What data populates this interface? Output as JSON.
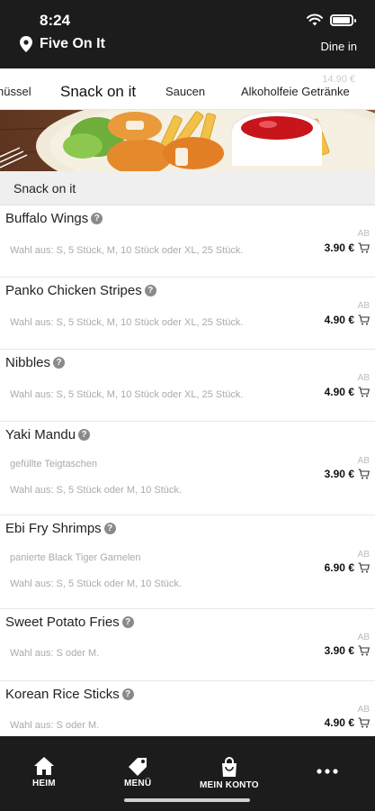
{
  "status": {
    "time": "8:24"
  },
  "header": {
    "location": "Five On It",
    "mode": "Dine in"
  },
  "tabs": [
    {
      "label": "hüssel"
    },
    {
      "label": "Snack on it",
      "active": true
    },
    {
      "label": "Saucen"
    },
    {
      "label": "Alkoholfeie Getränke"
    }
  ],
  "tabs_ghost": "14.90 €",
  "section": {
    "title": "Snack on it"
  },
  "items": [
    {
      "name": "Buffalo Wings",
      "subtitle": "",
      "options": "Wahl aus: S, 5 Stück, M, 10 Stück oder XL, 25 Stück.",
      "ab": "AB",
      "price": "3.90 €"
    },
    {
      "name": "Panko Chicken Stripes",
      "subtitle": "",
      "options": "Wahl aus: S, 5 Stück, M, 10 Stück oder XL, 25 Stück.",
      "ab": "AB",
      "price": "4.90 €"
    },
    {
      "name": "Nibbles",
      "subtitle": "",
      "options": "Wahl aus: S, 5 Stück, M, 10 Stück oder XL, 25 Stück.",
      "ab": "AB",
      "price": "4.90 €"
    },
    {
      "name": "Yaki Mandu",
      "subtitle": "gefüllte Teigtaschen",
      "options": "Wahl aus: S, 5 Stück oder M, 10 Stück.",
      "ab": "AB",
      "price": "3.90 €"
    },
    {
      "name": "Ebi Fry Shrimps",
      "subtitle": "panierte Black Tiger Garnelen",
      "options": "Wahl aus: S, 5 Stück oder M, 10 Stück.",
      "ab": "AB",
      "price": "6.90 €"
    },
    {
      "name": "Sweet Potato Fries",
      "subtitle": "",
      "options": "Wahl aus: S oder M.",
      "ab": "AB",
      "price": "3.90 €"
    },
    {
      "name": "Korean Rice Sticks",
      "subtitle": "",
      "options": "Wahl aus: S oder M.",
      "ab": "AB",
      "price": "4.90 €"
    }
  ],
  "bottom_nav": [
    {
      "label": "HEIM",
      "icon": "home-icon"
    },
    {
      "label": "MENÜ",
      "icon": "tag-icon"
    },
    {
      "label": "MEIN KONTO",
      "icon": "bag-icon"
    },
    {
      "label": "",
      "icon": "more-icon"
    }
  ],
  "colors": {
    "dark": "#1c1c1c",
    "muted": "#aaaaaa",
    "section": "#efefef"
  }
}
